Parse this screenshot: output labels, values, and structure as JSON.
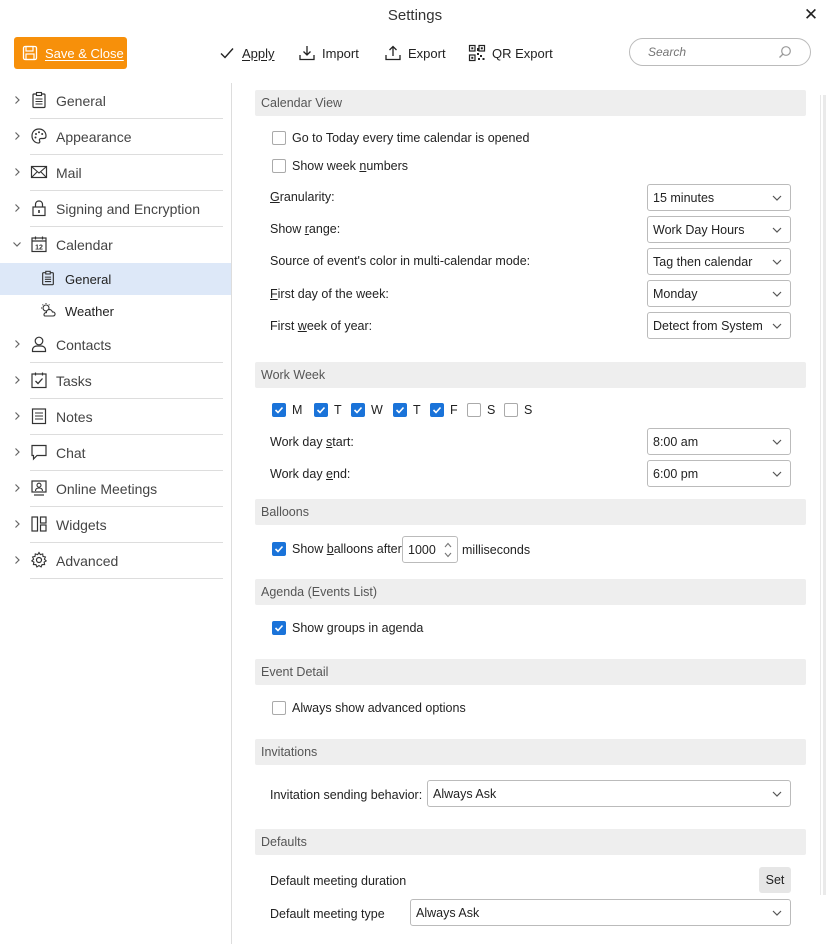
{
  "window": {
    "title": "Settings",
    "close_glyph": "✕"
  },
  "toolbar": {
    "save_label": "Save & Close",
    "apply_label": "Apply",
    "import_label": "Import",
    "export_label": "Export",
    "qr_export_label": "QR Export",
    "search_placeholder": "Search",
    "accent_color": "#f7900a"
  },
  "sidebar": {
    "items": [
      {
        "label": "General",
        "icon": "clipboard-icon"
      },
      {
        "label": "Appearance",
        "icon": "palette-icon"
      },
      {
        "label": "Mail",
        "icon": "envelope-icon"
      },
      {
        "label": "Signing and Encryption",
        "icon": "lock-icon"
      },
      {
        "label": "Calendar",
        "icon": "calendar-icon",
        "expanded": true
      },
      {
        "label": "Contacts",
        "icon": "person-icon"
      },
      {
        "label": "Tasks",
        "icon": "task-check-icon"
      },
      {
        "label": "Notes",
        "icon": "notes-icon"
      },
      {
        "label": "Chat",
        "icon": "chat-bubble-icon"
      },
      {
        "label": "Online Meetings",
        "icon": "meeting-icon"
      },
      {
        "label": "Widgets",
        "icon": "widgets-icon"
      },
      {
        "label": "Advanced",
        "icon": "gear-icon"
      }
    ],
    "calendar_sub": [
      {
        "label": "General",
        "icon": "clipboard-icon",
        "active": true
      },
      {
        "label": "Weather",
        "icon": "weather-icon"
      }
    ],
    "active_color": "#dde8f8"
  },
  "calendar_view": {
    "header": "Calendar View",
    "go_today": {
      "label": "Go to Today every time calendar is opened",
      "checked": false
    },
    "week_numbers": {
      "label_pre": "Show week ",
      "label_acc": "n",
      "label_post": "umbers",
      "checked": false
    },
    "granularity": {
      "label_acc": "G",
      "label_post": "ranularity:",
      "value": "15 minutes"
    },
    "show_range": {
      "label_pre": "Show ",
      "label_acc": "r",
      "label_post": "ange:",
      "value": "Work Day Hours"
    },
    "color_source": {
      "label": "Source of event's color in multi-calendar mode:",
      "value": "Tag then calendar"
    },
    "first_day": {
      "label_acc": "F",
      "label_post": "irst day of the week:",
      "value": "Monday"
    },
    "first_week": {
      "label_pre": "First ",
      "label_acc": "w",
      "label_post": "eek of year:",
      "value": "Detect from System"
    }
  },
  "work_week": {
    "header": "Work Week",
    "days": [
      {
        "label": "M",
        "checked": true
      },
      {
        "label": "T",
        "checked": true
      },
      {
        "label": "W",
        "checked": true
      },
      {
        "label": "T",
        "checked": true
      },
      {
        "label": "F",
        "checked": true
      },
      {
        "label": "S",
        "checked": false
      },
      {
        "label": "S",
        "checked": false
      }
    ],
    "start": {
      "label_pre": "Work day ",
      "label_acc": "s",
      "label_post": "tart:",
      "value": "8:00 am"
    },
    "end": {
      "label_pre": "Work day ",
      "label_acc": "e",
      "label_post": "nd:",
      "value": "6:00 pm"
    }
  },
  "balloons": {
    "header": "Balloons",
    "label_pre": "Show ",
    "label_acc": "b",
    "label_post": "alloons after",
    "checked": true,
    "value": "1000",
    "suffix": "milliseconds"
  },
  "agenda": {
    "header": "Agenda (Events List)",
    "label": "Show groups in agenda",
    "checked": true
  },
  "event_detail": {
    "header": "Event Detail",
    "label": "Always show advanced options",
    "checked": false
  },
  "invitations": {
    "header": "Invitations",
    "label": "Invitation sending behavior:",
    "value": "Always Ask"
  },
  "defaults": {
    "header": "Defaults",
    "duration_label": "Default meeting duration",
    "set_label": "Set",
    "type_label": "Default meeting type",
    "type_value": "Always Ask"
  },
  "checkbox_color": "#1a73d9"
}
